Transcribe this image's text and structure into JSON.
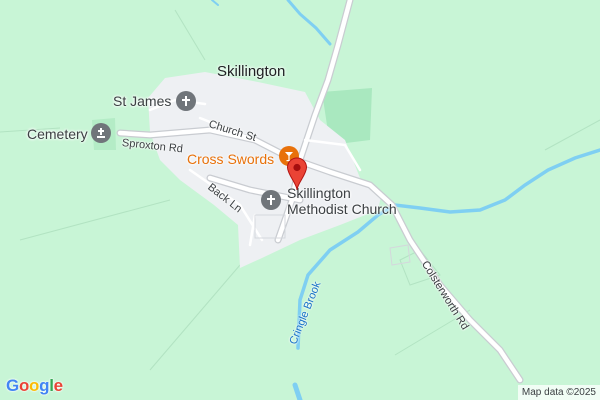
{
  "map": {
    "place_label": "Skillington",
    "pois": {
      "st_james": "St James",
      "cemetery": "Cemetery",
      "cross_swords": "Cross Swords",
      "methodist_line1": "Skillington",
      "methodist_line2": "Methodist Church"
    },
    "streets": {
      "church_st": "Church St",
      "sproxton_rd": "Sproxton Rd",
      "back_ln": "Back Ln",
      "colsterworth_rd": "Colsterworth Rd"
    },
    "water": {
      "cringle_brook": "Cringle Brook"
    },
    "logo": {
      "letters": [
        "G",
        "o",
        "o",
        "g",
        "l",
        "e"
      ],
      "colors": [
        "#4285F4",
        "#EA4335",
        "#FBBC05",
        "#4285F4",
        "#34A853",
        "#EA4335"
      ]
    },
    "attribution": "Map data ©2025",
    "colors": {
      "land": "#c8f5d6",
      "park": "#a8e6bd",
      "settlement": "#eef0f3",
      "water": "#7fcff2",
      "road": "#ffffff",
      "poi_orange": "#e8710a",
      "poi_grey": "#70757a",
      "marker": "#ea4335"
    },
    "icons": {
      "church": "church-icon",
      "cemetery": "cemetery-icon",
      "bar": "cocktail-icon",
      "marker": "map-pin-icon"
    }
  }
}
